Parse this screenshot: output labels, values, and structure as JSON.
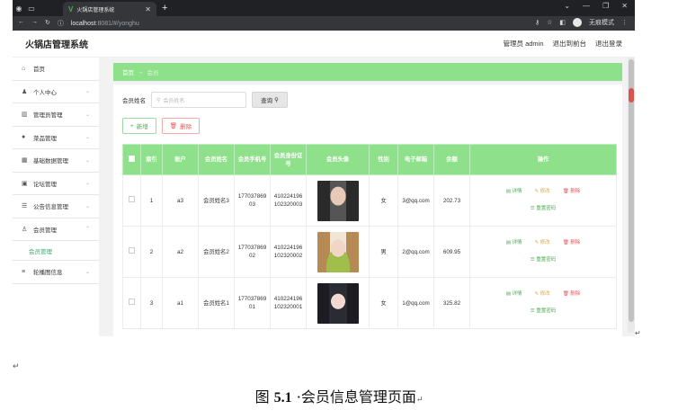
{
  "browser": {
    "tab_title": "火锅店管理系统",
    "url_host": "localhost",
    "url_rest": ":8081/#/yonghu",
    "incognito_label": "无痕模式"
  },
  "header": {
    "title": "火锅店管理系统",
    "links": [
      "管理员 admin",
      "退出到前台",
      "退出登录"
    ]
  },
  "sidebar": {
    "items": [
      {
        "label": "首页",
        "icon": "home-icon",
        "glyph": "⌂",
        "chevron": false
      },
      {
        "label": "个人中心",
        "icon": "user-icon",
        "glyph": "👤",
        "chevron": true
      },
      {
        "label": "管理员管理",
        "icon": "chart-icon",
        "glyph": "▥",
        "chevron": true
      },
      {
        "label": "菜品管理",
        "icon": "pin-icon",
        "glyph": "●",
        "chevron": true
      },
      {
        "label": "基础数据管理",
        "icon": "grid-icon",
        "glyph": "▦",
        "chevron": true
      },
      {
        "label": "论坛管理",
        "icon": "forum-icon",
        "glyph": "▣",
        "chevron": true
      },
      {
        "label": "公告信息管理",
        "icon": "sliders-icon",
        "glyph": "☰",
        "chevron": true
      },
      {
        "label": "会员管理",
        "icon": "member-icon",
        "glyph": "♙",
        "chevron": true,
        "open": true
      },
      {
        "label": "轮播图信息",
        "icon": "list-icon",
        "glyph": "≡",
        "chevron": true
      }
    ],
    "sub_item": "会员管理"
  },
  "breadcrumb": {
    "home": "首页",
    "arrow": "→",
    "current": "会员"
  },
  "search": {
    "label": "会员姓名",
    "placeholder": "会员姓名",
    "button": "查询"
  },
  "actions": {
    "add": "新增",
    "delete": "删除"
  },
  "table": {
    "headers": [
      "",
      "索引",
      "账户",
      "会员姓名",
      "会员手机号",
      "会员身份证号",
      "会员头像",
      "性别",
      "电子邮箱",
      "余额",
      "操作"
    ],
    "rows": [
      {
        "index": "1",
        "account": "a3",
        "name": "会员姓名3",
        "phone": "17703786903",
        "idcard": "410224196102320003",
        "gender": "女",
        "email": "3@qq.com",
        "balance": "202.73"
      },
      {
        "index": "2",
        "account": "a2",
        "name": "会员姓名2",
        "phone": "17703786902",
        "idcard": "410224196102320002",
        "gender": "男",
        "email": "2@qq.com",
        "balance": "609.95"
      },
      {
        "index": "3",
        "account": "a1",
        "name": "会员姓名1",
        "phone": "17703786901",
        "idcard": "410224196102320001",
        "gender": "女",
        "email": "1@qq.com",
        "balance": "325.82"
      }
    ],
    "ops": {
      "detail": "详情",
      "edit": "修改",
      "delete": "删除",
      "reset": "重置密码"
    }
  },
  "caption": {
    "label": "图",
    "number": "5.1",
    "text": "会员信息管理页面"
  },
  "colors": {
    "accent": "#8fe08b",
    "link_green": "#4caf50",
    "danger": "#e55"
  }
}
